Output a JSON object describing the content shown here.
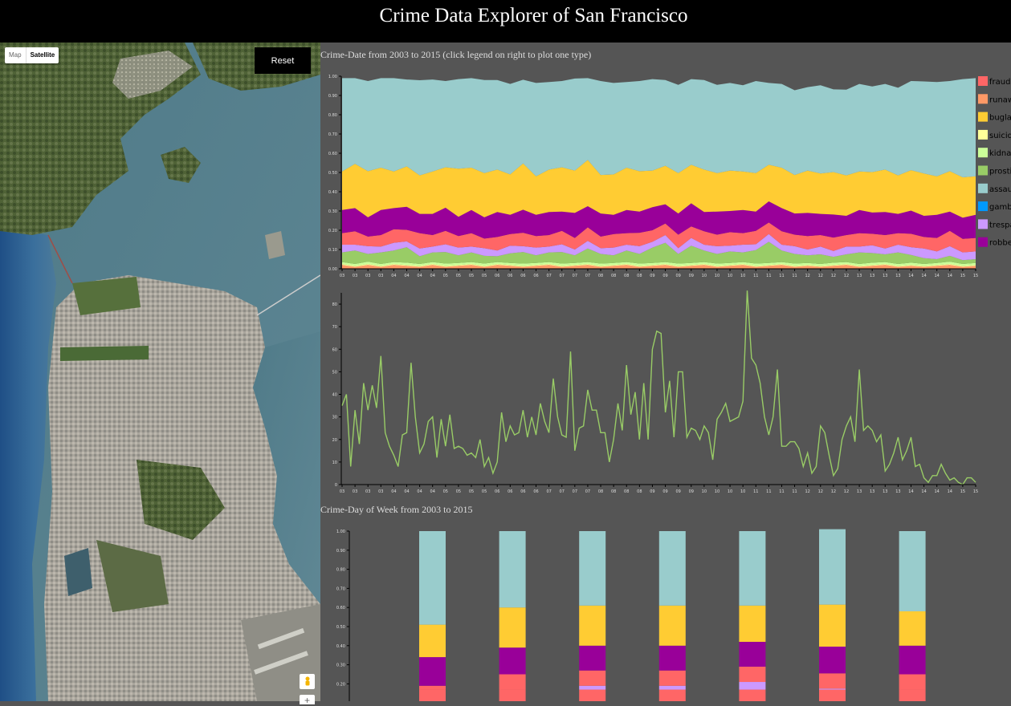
{
  "header": {
    "title": "Crime Data Explorer of San Francisco"
  },
  "map": {
    "type_options": [
      "Map",
      "Satellite"
    ],
    "selected_type": "Satellite",
    "reset_label": "Reset",
    "pegman_icon": "street-view-pegman-icon",
    "zoom_in_label": "+"
  },
  "colors": {
    "fraud": "#ff6666",
    "runaway": "#ff9966",
    "burglary": "#ffcc33",
    "suicide": "#ffff99",
    "kidnapping": "#ccff99",
    "prostitution": "#99cc66",
    "assault": "#99cccc",
    "gambling": "#0099ff",
    "trespass": "#cc99ff",
    "robbery": "#990099",
    "single_line": "#99cc66"
  },
  "charts": {
    "date_title": "Crime-Date from 2003 to 2015 (click legend on right to plot one type)",
    "dow_title": "Crime-Day of Week from 2003 to 2015"
  },
  "chart_data": [
    {
      "type": "area",
      "stacked": true,
      "normalized": true,
      "ylim": [
        0,
        1
      ],
      "y_ticks": [
        "0.00",
        "0.10",
        "0.20",
        "0.30",
        "0.40",
        "0.50",
        "0.60",
        "0.70",
        "0.80",
        "0.90",
        "1.00"
      ],
      "x_ticks": [
        "03",
        "03",
        "03",
        "03",
        "04",
        "04",
        "04",
        "04",
        "05",
        "05",
        "05",
        "05",
        "06",
        "06",
        "06",
        "06",
        "07",
        "07",
        "07",
        "07",
        "08",
        "08",
        "08",
        "08",
        "09",
        "09",
        "09",
        "09",
        "10",
        "10",
        "10",
        "10",
        "11",
        "11",
        "11",
        "11",
        "12",
        "12",
        "12",
        "12",
        "13",
        "13",
        "13",
        "13",
        "14",
        "14",
        "14",
        "14",
        "15",
        "15"
      ],
      "legend": [
        "fraud",
        "runaw",
        "buglar",
        "suicide",
        "kidnap",
        "prosti",
        "assaul",
        "gambl",
        "trespa",
        "robber"
      ],
      "legend_keys": [
        "fraud",
        "runaway",
        "burglary",
        "suicide",
        "kidnapping",
        "prostitution",
        "assault",
        "gambling",
        "trespass",
        "robbery"
      ],
      "legend_position": "right",
      "series_order_bottom_to_top": [
        "runaway",
        "suicide",
        "kidnapping",
        "prostitution",
        "trespass",
        "fraud",
        "robbery",
        "burglary",
        "assault"
      ],
      "series": {
        "runaway": [
          0.02,
          0.01,
          0.02,
          0.01,
          0.02,
          0.015,
          0.01,
          0.02,
          0.01,
          0.015,
          0.02,
          0.01,
          0.02,
          0.015,
          0.01,
          0.015,
          0.02,
          0.01,
          0.015,
          0.02,
          0.01,
          0.015,
          0.02,
          0.01,
          0.015,
          0.02,
          0.01,
          0.015,
          0.02,
          0.01,
          0.015,
          0.02,
          0.01,
          0.015,
          0.02,
          0.01,
          0.015,
          0.01,
          0.015,
          0.02,
          0.01,
          0.015,
          0.02,
          0.01,
          0.015,
          0.01,
          0.015,
          0.02,
          0.01,
          0.015
        ],
        "suicide": [
          0.005,
          0.005,
          0.005,
          0.005,
          0.005,
          0.005,
          0.005,
          0.005,
          0.005,
          0.005,
          0.005,
          0.005,
          0.005,
          0.005,
          0.005,
          0.005,
          0.005,
          0.005,
          0.005,
          0.005,
          0.005,
          0.005,
          0.005,
          0.005,
          0.005,
          0.005,
          0.005,
          0.005,
          0.005,
          0.005,
          0.005,
          0.005,
          0.005,
          0.005,
          0.005,
          0.005,
          0.005,
          0.005,
          0.005,
          0.005,
          0.005,
          0.005,
          0.005,
          0.005,
          0.005,
          0.005,
          0.005,
          0.005,
          0.005,
          0.005
        ],
        "kidnapping": [
          0.01,
          0.01,
          0.012,
          0.01,
          0.01,
          0.012,
          0.01,
          0.01,
          0.012,
          0.01,
          0.01,
          0.012,
          0.01,
          0.01,
          0.012,
          0.01,
          0.01,
          0.012,
          0.01,
          0.01,
          0.012,
          0.01,
          0.01,
          0.012,
          0.01,
          0.01,
          0.012,
          0.01,
          0.01,
          0.012,
          0.01,
          0.01,
          0.012,
          0.01,
          0.01,
          0.012,
          0.01,
          0.01,
          0.012,
          0.01,
          0.01,
          0.012,
          0.01,
          0.01,
          0.012,
          0.01,
          0.01,
          0.012,
          0.01,
          0.01
        ],
        "prostitution": [
          0.05,
          0.07,
          0.04,
          0.06,
          0.06,
          0.08,
          0.04,
          0.05,
          0.06,
          0.04,
          0.05,
          0.04,
          0.03,
          0.05,
          0.06,
          0.04,
          0.05,
          0.06,
          0.04,
          0.07,
          0.05,
          0.04,
          0.06,
          0.05,
          0.08,
          0.1,
          0.05,
          0.09,
          0.06,
          0.05,
          0.06,
          0.05,
          0.07,
          0.11,
          0.06,
          0.05,
          0.04,
          0.05,
          0.03,
          0.04,
          0.06,
          0.05,
          0.04,
          0.06,
          0.04,
          0.03,
          0.02,
          0.03,
          0.02,
          0.02
        ],
        "trespass": [
          0.04,
          0.03,
          0.04,
          0.03,
          0.04,
          0.03,
          0.04,
          0.03,
          0.04,
          0.04,
          0.03,
          0.04,
          0.03,
          0.04,
          0.03,
          0.04,
          0.03,
          0.04,
          0.03,
          0.04,
          0.03,
          0.04,
          0.03,
          0.04,
          0.03,
          0.04,
          0.03,
          0.04,
          0.03,
          0.04,
          0.03,
          0.04,
          0.03,
          0.04,
          0.03,
          0.04,
          0.03,
          0.04,
          0.03,
          0.04,
          0.03,
          0.04,
          0.03,
          0.04,
          0.04,
          0.05,
          0.04,
          0.05,
          0.04,
          0.04
        ],
        "fraud": [
          0.06,
          0.07,
          0.05,
          0.06,
          0.07,
          0.06,
          0.08,
          0.06,
          0.07,
          0.06,
          0.07,
          0.05,
          0.07,
          0.06,
          0.07,
          0.06,
          0.06,
          0.07,
          0.06,
          0.07,
          0.06,
          0.07,
          0.06,
          0.07,
          0.06,
          0.06,
          0.07,
          0.06,
          0.07,
          0.06,
          0.07,
          0.06,
          0.07,
          0.06,
          0.07,
          0.06,
          0.07,
          0.06,
          0.07,
          0.06,
          0.07,
          0.06,
          0.07,
          0.06,
          0.07,
          0.06,
          0.07,
          0.08,
          0.07,
          0.07
        ],
        "robbery": [
          0.12,
          0.12,
          0.1,
          0.13,
          0.11,
          0.12,
          0.1,
          0.11,
          0.12,
          0.1,
          0.12,
          0.11,
          0.13,
          0.1,
          0.12,
          0.11,
          0.12,
          0.1,
          0.13,
          0.11,
          0.12,
          0.1,
          0.12,
          0.11,
          0.12,
          0.1,
          0.11,
          0.12,
          0.1,
          0.12,
          0.11,
          0.12,
          0.1,
          0.11,
          0.12,
          0.11,
          0.12,
          0.11,
          0.12,
          0.1,
          0.12,
          0.11,
          0.12,
          0.1,
          0.12,
          0.11,
          0.12,
          0.1,
          0.11,
          0.12
        ],
        "burglary": [
          0.2,
          0.23,
          0.24,
          0.22,
          0.19,
          0.21,
          0.2,
          0.22,
          0.21,
          0.25,
          0.22,
          0.23,
          0.22,
          0.21,
          0.24,
          0.2,
          0.22,
          0.23,
          0.22,
          0.24,
          0.2,
          0.21,
          0.22,
          0.21,
          0.19,
          0.2,
          0.21,
          0.2,
          0.22,
          0.2,
          0.21,
          0.2,
          0.2,
          0.19,
          0.21,
          0.2,
          0.22,
          0.21,
          0.22,
          0.21,
          0.2,
          0.21,
          0.22,
          0.2,
          0.21,
          0.22,
          0.2,
          0.21,
          0.21,
          0.2
        ],
        "assault": [
          0.485,
          0.445,
          0.468,
          0.465,
          0.485,
          0.451,
          0.494,
          0.478,
          0.448,
          0.465,
          0.465,
          0.483,
          0.465,
          0.47,
          0.435,
          0.485,
          0.455,
          0.448,
          0.478,
          0.425,
          0.488,
          0.475,
          0.445,
          0.468,
          0.475,
          0.445,
          0.458,
          0.445,
          0.465,
          0.458,
          0.455,
          0.448,
          0.478,
          0.425,
          0.435,
          0.44,
          0.433,
          0.458,
          0.43,
          0.445,
          0.455,
          0.445,
          0.445,
          0.455,
          0.463,
          0.478,
          0.49,
          0.468,
          0.51,
          0.51
        ]
      }
    },
    {
      "type": "line",
      "ylim": [
        0,
        85
      ],
      "y_ticks": [
        "0",
        "10",
        "20",
        "30",
        "40",
        "50",
        "60",
        "70",
        "80"
      ],
      "x_ticks": [
        "03",
        "03",
        "03",
        "03",
        "04",
        "04",
        "04",
        "04",
        "05",
        "05",
        "05",
        "05",
        "06",
        "06",
        "06",
        "06",
        "07",
        "07",
        "07",
        "07",
        "08",
        "08",
        "08",
        "08",
        "09",
        "09",
        "09",
        "09",
        "10",
        "10",
        "10",
        "10",
        "11",
        "11",
        "11",
        "11",
        "12",
        "12",
        "12",
        "12",
        "13",
        "13",
        "13",
        "13",
        "14",
        "14",
        "14",
        "14",
        "15",
        "15"
      ],
      "values": [
        35,
        40,
        8,
        33,
        18,
        45,
        33,
        44,
        34,
        57,
        23,
        17,
        13,
        8,
        22,
        23,
        54,
        30,
        14,
        18,
        28,
        30,
        12,
        29,
        17,
        31,
        16,
        17,
        16,
        13,
        14,
        12,
        20,
        8,
        12,
        5,
        10,
        32,
        19,
        26,
        22,
        23,
        33,
        21,
        30,
        22,
        36,
        28,
        23,
        47,
        30,
        22,
        21,
        59,
        15,
        25,
        26,
        42,
        33,
        33,
        23,
        23,
        10,
        20,
        36,
        24,
        53,
        31,
        41,
        20,
        45,
        20,
        60,
        68,
        67,
        32,
        46,
        21,
        50,
        50,
        21,
        25,
        24,
        20,
        26,
        23,
        11,
        29,
        32,
        36,
        28,
        29,
        30,
        37,
        86,
        56,
        53,
        45,
        30,
        22,
        30,
        51,
        17,
        17,
        19,
        19,
        16,
        8,
        14,
        5,
        8,
        26,
        23,
        13,
        4,
        7,
        20,
        26,
        30,
        19,
        51,
        24,
        26,
        24,
        19,
        22,
        6,
        9,
        14,
        21,
        11,
        15,
        21,
        8,
        9,
        3,
        1,
        4,
        4,
        9,
        5,
        2,
        3,
        1,
        0,
        3,
        3,
        1
      ]
    },
    {
      "type": "bar",
      "stacked": true,
      "normalized": true,
      "ylim": [
        0,
        1
      ],
      "y_ticks": [
        "0.20",
        "0.30",
        "0.40",
        "0.50",
        "0.60",
        "0.70",
        "0.80",
        "0.90",
        "1.00"
      ],
      "categories": [
        "",
        "",
        "",
        "",
        "",
        "",
        ""
      ],
      "series": {
        "base": [
          0.17,
          0.17,
          0.17,
          0.17,
          0.17,
          0.17,
          0.17
        ],
        "trespass": [
          0.0,
          0.0,
          0.02,
          0.02,
          0.04,
          0.005,
          0.0
        ],
        "fraud": [
          0.02,
          0.08,
          0.08,
          0.08,
          0.08,
          0.08,
          0.08
        ],
        "robbery": [
          0.15,
          0.14,
          0.13,
          0.13,
          0.13,
          0.14,
          0.15
        ],
        "burglary": [
          0.17,
          0.21,
          0.21,
          0.21,
          0.19,
          0.22,
          0.18
        ],
        "assault": [
          0.49,
          0.4,
          0.39,
          0.39,
          0.39,
          0.395,
          0.42
        ]
      },
      "series_order_bottom_to_top": [
        "base",
        "trespass",
        "fraud",
        "robbery",
        "burglary",
        "assault"
      ]
    }
  ]
}
